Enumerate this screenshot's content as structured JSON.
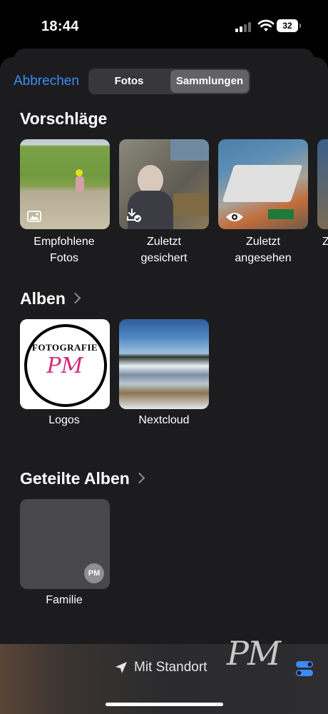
{
  "status": {
    "time": "18:44",
    "battery": "32"
  },
  "header": {
    "cancel_label": "Abbrechen",
    "tabs": [
      "Fotos",
      "Sammlungen"
    ],
    "selected_tab": "Sammlungen"
  },
  "suggestions": {
    "title": "Vorschläge",
    "items": [
      {
        "line1": "Empfohlene",
        "line2": "Fotos",
        "icon": "photo-icon"
      },
      {
        "line1": "Zuletzt",
        "line2": "gesichert",
        "icon": "download-check-icon"
      },
      {
        "line1": "Zuletzt",
        "line2": "angesehen",
        "icon": "eye-icon"
      },
      {
        "line1": "Z",
        "line2": ""
      }
    ]
  },
  "albums": {
    "title": "Alben",
    "items": [
      {
        "label": "Logos"
      },
      {
        "label": "Nextcloud"
      }
    ],
    "logo": {
      "text": "FOTOGRAFIE",
      "initials": "PM"
    }
  },
  "shared_albums": {
    "title": "Geteilte Alben",
    "items": [
      {
        "label": "Familie",
        "avatar": "PM"
      }
    ]
  },
  "bottom": {
    "location_label": "Mit Standort"
  },
  "watermark": {
    "pm": "PM"
  },
  "colors": {
    "accent": "#3d8bf6",
    "sheet": "#1c1c1e"
  }
}
